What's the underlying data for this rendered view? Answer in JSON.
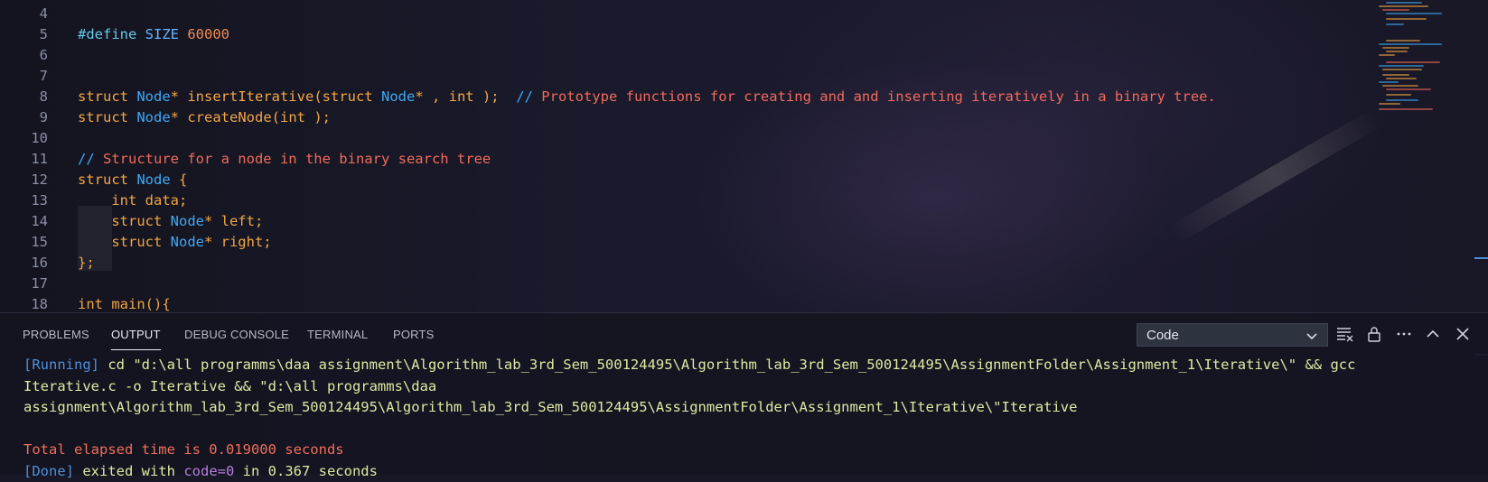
{
  "editor": {
    "lines": [
      {
        "num": "4"
      },
      {
        "num": "5",
        "segments": [
          [
            "k-pre",
            "#define "
          ],
          [
            "k-mac",
            "SIZE "
          ],
          [
            "k-num",
            "60000"
          ]
        ]
      },
      {
        "num": "6"
      },
      {
        "num": "7"
      },
      {
        "num": "8",
        "segments": [
          [
            "k-kw",
            "struct "
          ],
          [
            "k-type",
            "Node"
          ],
          [
            "k-kw",
            "* "
          ],
          [
            "k-fn",
            "insertIterative"
          ],
          [
            "k-txt",
            "("
          ],
          [
            "k-kw",
            "struct "
          ],
          [
            "k-type",
            "Node"
          ],
          [
            "k-kw",
            "* , int );  "
          ],
          [
            "k-cmslash",
            "// "
          ],
          [
            "k-cm",
            "Prototype functions for creating and and inserting iteratively in a binary tree."
          ]
        ]
      },
      {
        "num": "9",
        "segments": [
          [
            "k-kw",
            "struct "
          ],
          [
            "k-type",
            "Node"
          ],
          [
            "k-kw",
            "* "
          ],
          [
            "k-fn",
            "createNode"
          ],
          [
            "k-txt",
            "(int );"
          ]
        ]
      },
      {
        "num": "10"
      },
      {
        "num": "11",
        "segments": [
          [
            "k-cmslash",
            "// "
          ],
          [
            "k-cm",
            "Structure for a node in the binary search tree"
          ]
        ]
      },
      {
        "num": "12",
        "segments": [
          [
            "k-kw",
            "struct "
          ],
          [
            "k-type",
            "Node "
          ],
          [
            "k-txt",
            "{"
          ]
        ]
      },
      {
        "num": "13",
        "segments": [
          [
            "k-txt",
            "    int data;"
          ]
        ]
      },
      {
        "num": "14",
        "segments": [
          [
            "k-txt",
            "    struct "
          ],
          [
            "k-type",
            "Node"
          ],
          [
            "k-txt",
            "* left;"
          ]
        ]
      },
      {
        "num": "15",
        "segments": [
          [
            "k-txt",
            "    struct "
          ],
          [
            "k-type",
            "Node"
          ],
          [
            "k-txt",
            "* right;"
          ]
        ]
      },
      {
        "num": "16",
        "segments": [
          [
            "k-txt",
            "};"
          ]
        ]
      },
      {
        "num": "17"
      },
      {
        "num": "18",
        "segments": [
          [
            "k-kw",
            "int "
          ],
          [
            "k-fn",
            "main"
          ],
          [
            "k-txt",
            "(){"
          ]
        ]
      }
    ]
  },
  "panel": {
    "tabs": [
      {
        "label": "PROBLEMS",
        "active": false
      },
      {
        "label": "OUTPUT",
        "active": true
      },
      {
        "label": "DEBUG CONSOLE",
        "active": false
      },
      {
        "label": "TERMINAL",
        "active": false
      },
      {
        "label": "PORTS",
        "active": false
      }
    ],
    "channel_select": "Code",
    "icons": [
      "clear-output-icon",
      "lock-icon",
      "more-actions-icon",
      "maximize-panel-icon",
      "close-panel-icon"
    ],
    "output": {
      "line1_tag": "[Running]",
      "line1_text": " cd \"d:\\all programms\\daa assignment\\Algorithm_lab_3rd_Sem_500124495\\Algorithm_lab_3rd_Sem_500124495\\AssignmentFolder\\Assignment_1\\Iterative\\\" && gcc",
      "line2": "Iterative.c -o Iterative && \"d:\\all programms\\daa",
      "line3": "assignment\\Algorithm_lab_3rd_Sem_500124495\\Algorithm_lab_3rd_Sem_500124495\\AssignmentFolder\\Assignment_1\\Iterative\\\"Iterative",
      "line4": "",
      "line5": "Total elapsed time is 0.019000 seconds",
      "line6_tag": "[Done]",
      "line6_a": " exited with ",
      "line6_code": "code=0",
      "line6_b": " in 0.367 seconds"
    }
  },
  "colors": {
    "accent": "#4d90d8",
    "keyword": "#f4a545",
    "type": "#3fa9f5",
    "comment": "#f26a5a"
  }
}
